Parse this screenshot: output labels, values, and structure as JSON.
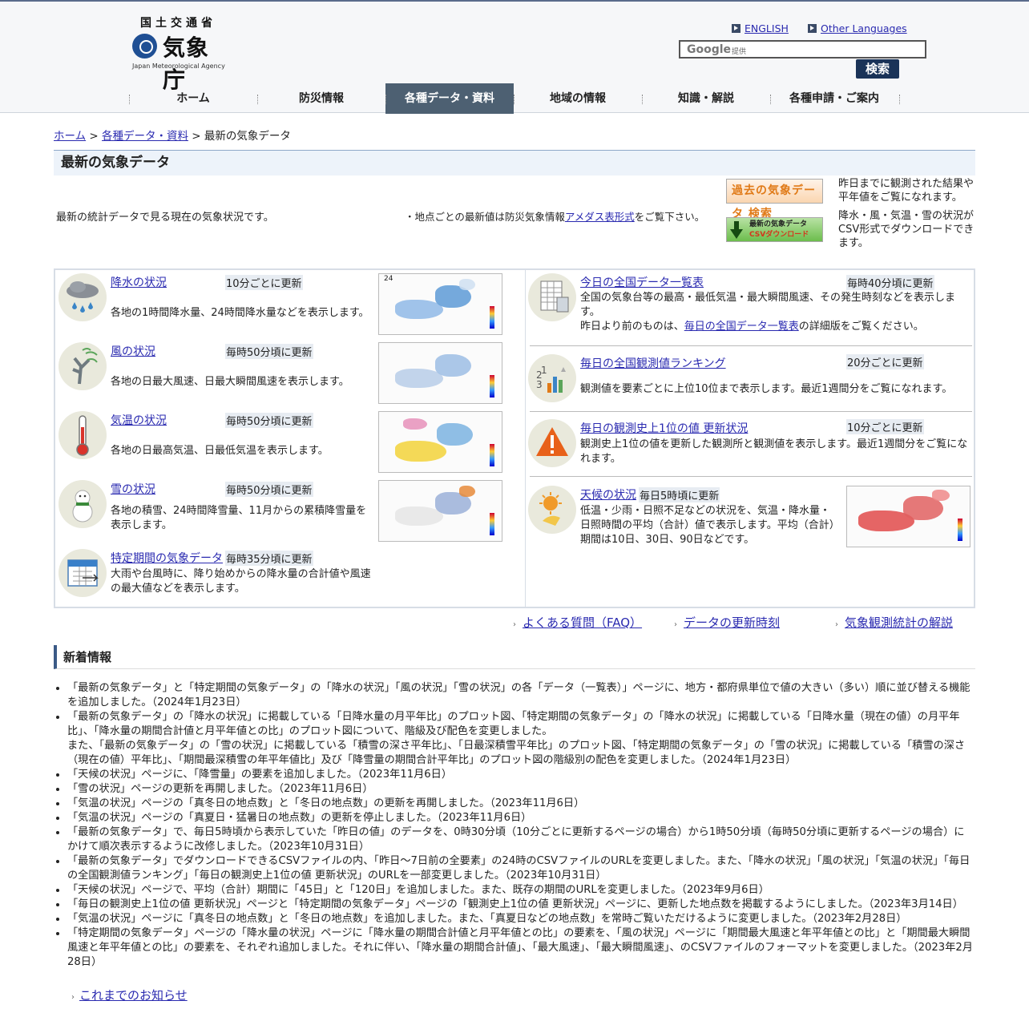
{
  "header": {
    "ministry": "国土交通省",
    "agency": "気象庁",
    "agency_en": "Japan Meteorological Agency",
    "english_link": "ENGLISH",
    "other_lang_link": "Other Languages",
    "search_brand": "Google",
    "search_brand_sub": "提供",
    "search_button": "検索"
  },
  "nav": [
    "ホーム",
    "防災情報",
    "各種データ・資料",
    "地域の情報",
    "知識・解説",
    "各種申請・ご案内"
  ],
  "breadcrumb": {
    "home": "ホーム",
    "sep1": " > ",
    "data": "各種データ・資料",
    "sep2": " > ",
    "current": "最新の気象データ"
  },
  "page_title": "最新の気象データ",
  "intro": "最新の統計データで見る現在の気象状況です。",
  "amedas": {
    "prefix": "・地点ごとの最新値は防災気象情報",
    "link": "アメダス表形式",
    "suffix": "をご覧下さい。"
  },
  "banners": {
    "past_label": "過去の気象データ 検索",
    "past_desc": "昨日までに観測された結果や平年値をご覧になれます。",
    "csv_label_1": "最新の気象データ",
    "csv_label_2": "CSVダウンロード",
    "csv_desc": "降水・風・気温・雪の状況がCSV形式でダウンロードできます。"
  },
  "left_entries": [
    {
      "title": "降水の状況",
      "freq": "10分ごとに更新",
      "desc": "各地の1時間降水量、24時間降水量などを表示します。"
    },
    {
      "title": "風の状況",
      "freq": "毎時50分頃に更新",
      "desc": "各地の日最大風速、日最大瞬間風速を表示します。"
    },
    {
      "title": "気温の状況",
      "freq": "毎時50分頃に更新",
      "desc": "各地の日最高気温、日最低気温を表示します。"
    },
    {
      "title": "雪の状況",
      "freq": "毎時50分頃に更新",
      "desc": "各地の積雪、24時間降雪量、11月からの累積降雪量を表示します。"
    },
    {
      "title": "特定期間の気象データ",
      "freq": "毎時35分頃に更新",
      "desc": "大雨や台風時に、降り始めからの降水量の合計値や風速の最大値などを表示します。"
    }
  ],
  "right_entries": [
    {
      "title": "今日の全国データ一覧表",
      "freq": "毎時40分頃に更新",
      "desc": "全国の気象台等の最高・最低気温・最大瞬間風速、その発生時刻などを表示します。",
      "desc2_prefix": "昨日より前のものは、",
      "desc2_link": "毎日の全国データ一覧表",
      "desc2_suffix": "の詳細版をご覧ください。"
    },
    {
      "title": "毎日の全国観測値ランキング",
      "freq": "20分ごとに更新",
      "desc": "観測値を要素ごとに上位10位まで表示します。最近1週間分をご覧になれます。"
    },
    {
      "title": "毎日の観測史上1位の値 更新状況",
      "freq": "10分ごとに更新",
      "desc": "観測史上1位の値を更新した観測所と観測値を表示します。最近1週間分をご覧になれます。"
    },
    {
      "title": "天候の状況",
      "freq": "毎日5時頃に更新",
      "desc": "低温・少雨・日照不足などの状況を、気温・降水量・日照時間の平均（合計）値で表示します。平均（合計）期間は10日、30日、90日などです。"
    }
  ],
  "bottom_links": [
    "よくある質問（FAQ）",
    "データの更新時刻",
    "気象観測統計の解説"
  ],
  "news_heading": "新着情報",
  "news": [
    "「最新の気象データ」と「特定期間の気象データ」の「降水の状況」「風の状況」「雪の状況」の各「データ（一覧表）」ページに、地方・都府県単位で値の大きい（多い）順に並び替える機能を追加しました。（2024年1月23日）",
    "「最新の気象データ」の「降水の状況」に掲載している「日降水量の月平年比」のプロット図、「特定期間の気象データ」の「降水の状況」に掲載している「日降水量（現在の値）の月平年比」、「降水量の期間合計値と月平年値との比」のプロット図について、階級及び配色を変更しました。",
    "「天候の状況」ページに、「降雪量」の要素を追加しました。（2023年11月6日）",
    "「雪の状況」ページの更新を再開しました。（2023年11月6日）",
    "「気温の状況」ページの「真冬日の地点数」と「冬日の地点数」の更新を再開しました。（2023年11月6日）",
    "「気温の状況」ページの「真夏日・猛暑日の地点数」の更新を停止しました。（2023年11月6日）",
    "「最新の気象データ」で、毎日5時頃から表示していた「昨日の値」のデータを、0時30分頃（10分ごとに更新するページの場合）から1時50分頃（毎時50分頃に更新するページの場合）にかけて順次表示するように改修しました。（2023年10月31日）",
    "「最新の気象データ」でダウンロードできるCSVファイルの内、「昨日〜7日前の全要素」の24時のCSVファイルのURLを変更しました。また、「降水の状況」「風の状況」「気温の状況」「毎日の全国観測値ランキング」「毎日の観測史上1位の値 更新状況」のURLを一部変更しました。（2023年10月31日）",
    "「天候の状況」ページで、平均（合計）期間に「45日」と「120日」を追加しました。また、既存の期間のURLを変更しました。（2023年9月6日）",
    "「毎日の観測史上1位の値 更新状況」ページと「特定期間の気象データ」ページの「観測史上1位の値 更新状況」ページに、更新した地点数を掲載するようにしました。（2023年3月14日）",
    "「気温の状況」ページに「真冬日の地点数」と「冬日の地点数」を追加しました。また、「真夏日などの地点数」を常時ご覧いただけるように変更しました。（2023年2月28日）",
    "「特定期間の気象データ」ページの「降水量の状況」ページに「降水量の期間合計値と月平年値との比」の要素を、「風の状況」ページに「期間最大風速と年平年値との比」と「期間最大瞬間風速と年平年値との比」の要素を、それぞれ追加しました。それに伴い、「降水量の期間合計値」、「最大風速」、「最大瞬間風速」、のCSVファイルのフォーマットを変更しました。（2023年2月28日）"
  ],
  "news_extra": "また、「最新の気象データ」の「雪の状況」に掲載している「積雪の深さ平年比」、「日最深積雪平年比」のプロット図、「特定期間の気象データ」の「雪の状況」に掲載している「積雪の深さ（現在の値）平年比」、「期間最深積雪の年平年値比」及び「降雪量の期間合計平年比」のプロット図の階級別の配色を変更しました。（2024年1月23日）",
  "more_news": "これまでのお知らせ",
  "thumb_labels": [
    "24",
    "",
    "",
    "",
    ""
  ]
}
